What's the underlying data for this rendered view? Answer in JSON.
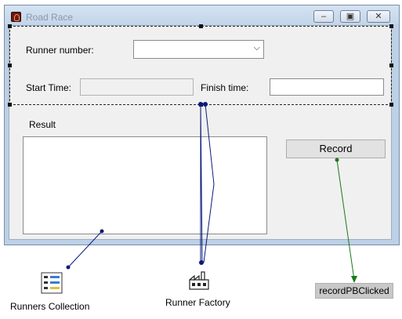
{
  "window": {
    "title": "Road Race",
    "controls": {
      "minimize": "minimize-icon",
      "maximize": "maximize-icon",
      "close": "close-icon"
    }
  },
  "form": {
    "runner_number_label": "Runner number:",
    "runner_number_value": "",
    "start_time_label": "Start Time:",
    "start_time_value": "",
    "finish_time_label": "Finish time:",
    "finish_time_value": "",
    "result_label": "Result",
    "record_button_label": "Record"
  },
  "components": {
    "collection": {
      "label": "Runners Collection",
      "icon": "list-collection-icon"
    },
    "factory": {
      "label": "Runner Factory",
      "icon": "factory-icon"
    },
    "signal": {
      "label": "recordPBClicked"
    }
  },
  "colors": {
    "connection_line": "#0a1a7a",
    "signal_line": "#1a7a1a",
    "window_frame": "#bcd0e6"
  }
}
